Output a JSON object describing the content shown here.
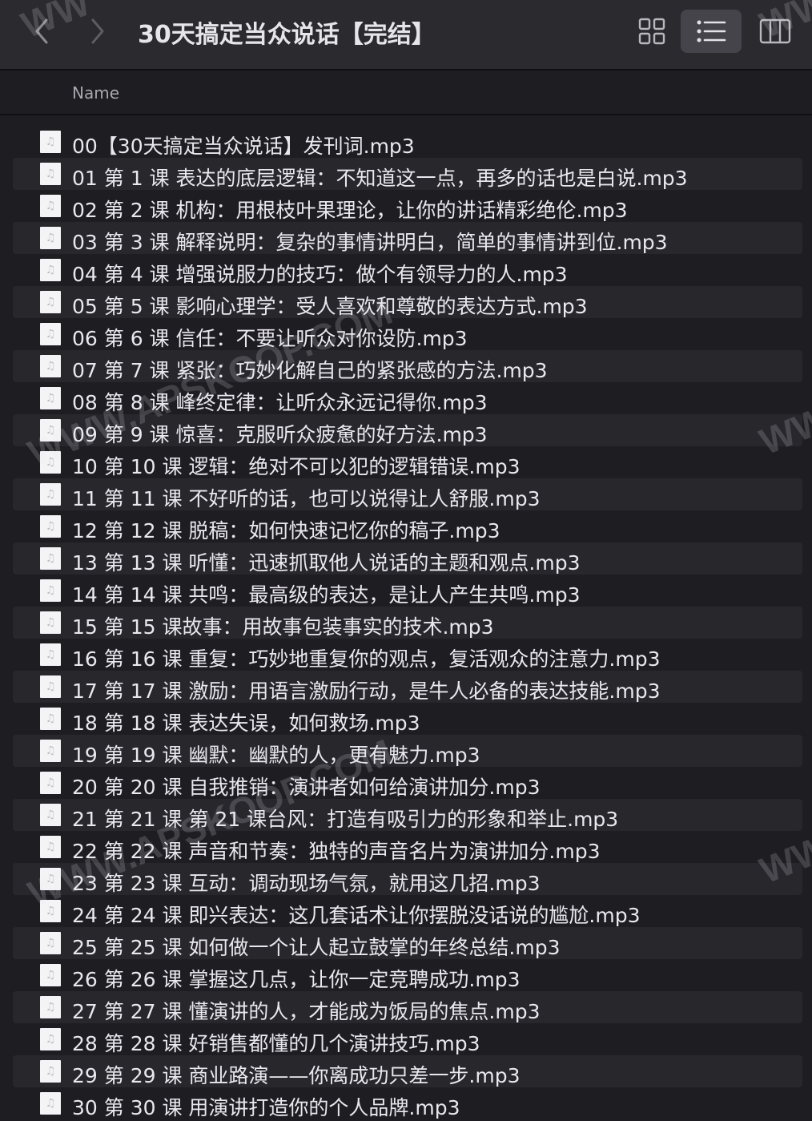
{
  "window": {
    "title": "30天搞定当众说话【完结】"
  },
  "toolbar": {
    "back_icon": "chevron-left-icon",
    "forward_icon": "chevron-right-icon",
    "views": [
      "grid-view-icon",
      "list-view-icon",
      "column-view-icon"
    ],
    "active_view": "list"
  },
  "columns": {
    "name": "Name"
  },
  "files": [
    {
      "name": "00【30天搞定当众说话】发刊词.mp3"
    },
    {
      "name": "01 第 1 课  表达的底层逻辑：不知道这一点，再多的话也是白说.mp3"
    },
    {
      "name": "02 第 2 课  机构：用根枝叶果理论，让你的讲话精彩绝伦.mp3"
    },
    {
      "name": "03 第 3 课  解释说明：复杂的事情讲明白，简单的事情讲到位.mp3"
    },
    {
      "name": "04 第 4 课  增强说服力的技巧：做个有领导力的人.mp3"
    },
    {
      "name": "05 第 5 课  影响心理学：受人喜欢和尊敬的表达方式.mp3"
    },
    {
      "name": "06 第 6 课  信任：不要让听众对你设防.mp3"
    },
    {
      "name": "07 第 7 课  紧张：巧妙化解自己的紧张感的方法.mp3"
    },
    {
      "name": "08 第 8 课  峰终定律：让听众永远记得你.mp3"
    },
    {
      "name": "09 第 9 课  惊喜：克服听众疲惫的好方法.mp3"
    },
    {
      "name": "10 第 10 课  逻辑：绝对不可以犯的逻辑错误.mp3"
    },
    {
      "name": "11 第 11 课  不好听的话，也可以说得让人舒服.mp3"
    },
    {
      "name": "12 第 12 课  脱稿：如何快速记忆你的稿子.mp3"
    },
    {
      "name": "13 第 13 课  听懂：迅速抓取他人说话的主题和观点.mp3"
    },
    {
      "name": "14 第 14 课  共鸣：最高级的表达，是让人产生共鸣.mp3"
    },
    {
      "name": "15 第 15 课故事：用故事包装事实的技术.mp3"
    },
    {
      "name": "16 第 16 课  重复：巧妙地重复你的观点，复活观众的注意力.mp3"
    },
    {
      "name": "17 第 17 课  激励：用语言激励行动，是牛人必备的表达技能.mp3"
    },
    {
      "name": "18 第 18 课  表达失误，如何救场.mp3"
    },
    {
      "name": "19 第 19 课  幽默：幽默的人，更有魅力.mp3"
    },
    {
      "name": "20 第 20 课  自我推销：演讲者如何给演讲加分.mp3"
    },
    {
      "name": "21 第 21 课 第 21 课台风：打造有吸引力的形象和举止.mp3"
    },
    {
      "name": "22 第 22 课  声音和节奏：独特的声音名片为演讲加分.mp3"
    },
    {
      "name": "23 第 23 课  互动：调动现场气氛，就用这几招.mp3"
    },
    {
      "name": "24 第 24 课  即兴表达：这几套话术让你摆脱没话说的尴尬.mp3"
    },
    {
      "name": "25 第 25 课  如何做一个让人起立鼓掌的年终总结.mp3"
    },
    {
      "name": "26 第 26 课  掌握这几点，让你一定竞聘成功.mp3"
    },
    {
      "name": "27 第 27 课  懂演讲的人，才能成为饭局的焦点.mp3"
    },
    {
      "name": "28 第 28 课  好销售都懂的几个演讲技巧.mp3"
    },
    {
      "name": "29 第 29 课  商业路演——你离成功只差一步.mp3"
    },
    {
      "name": "30 第 30 课  用演讲打造你的个人品牌.mp3"
    }
  ],
  "watermarks": [
    "WWW.APSKOOP.COM",
    "WWW.APSKOOP.COM",
    "WW",
    "WW",
    "WW",
    "WW"
  ]
}
